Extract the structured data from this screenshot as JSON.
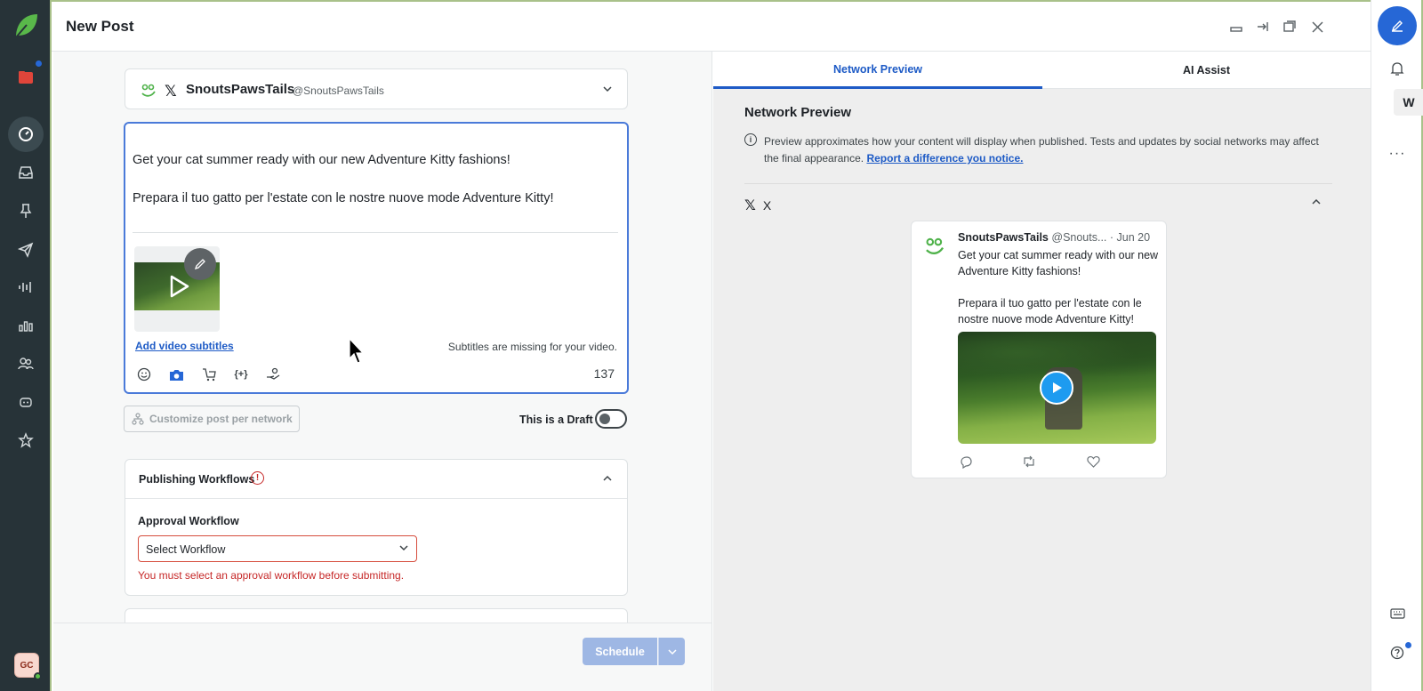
{
  "window": {
    "title": "New Post"
  },
  "account": {
    "name": "SnoutsPawsTails",
    "handle": "@SnoutsPawsTails"
  },
  "composer": {
    "line1": "Get your cat summer ready with our new Adventure Kitty fashions!",
    "line2": "Prepara il tuo gatto per l'estate con le nostre nuove mode Adventure Kitty!",
    "add_subtitles": "Add video subtitles",
    "subtitles_missing": "Subtitles are missing for your video.",
    "char_count": "137"
  },
  "customize_label": "Customize post per network",
  "draft_label": "This is a Draft",
  "workflow": {
    "section_title": "Publishing Workflows",
    "warn_glyph": "!",
    "field_label": "Approval Workflow",
    "select_value": "Select Workflow",
    "error": "You must select an approval workflow before submitting."
  },
  "footer": {
    "schedule_label": "Schedule"
  },
  "preview": {
    "tabs": [
      "Network Preview",
      "AI Assist"
    ],
    "title": "Network Preview",
    "info_text": "Preview approximates how your content will display when published. Tests and updates by social networks may affect the final appearance.",
    "info_link": "Report a difference you notice.",
    "network_name": "X",
    "tweet": {
      "name": "SnoutsPawsTails",
      "handle": "@Snouts...",
      "date": "· Jun 20",
      "text1": "Get your cat summer ready with our new Adventure Kitty fashions!",
      "text2": "Prepara il tuo gatto per l'estate con le nostre nuove mode Adventure Kitty!"
    }
  },
  "avatar": {
    "initials": "GC"
  },
  "colors": {
    "nav_bg": "#273338",
    "accent": "#1e5bc6",
    "error": "#c62828",
    "brand_green": "#5bbf4a"
  }
}
